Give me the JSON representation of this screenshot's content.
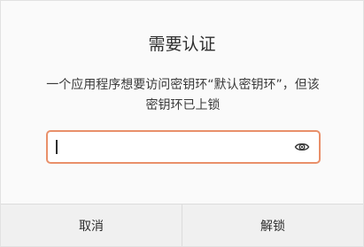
{
  "dialog": {
    "title": "需要认证",
    "message_line1": "一个应用程序想要访问密钥环“默认密钥环”，但该",
    "message_line2": "密钥环已上锁",
    "password_value": "",
    "reveal_icon": "eye-icon",
    "accent_color": "#e9906a",
    "buttons": {
      "cancel": "取消",
      "unlock": "解锁"
    }
  }
}
